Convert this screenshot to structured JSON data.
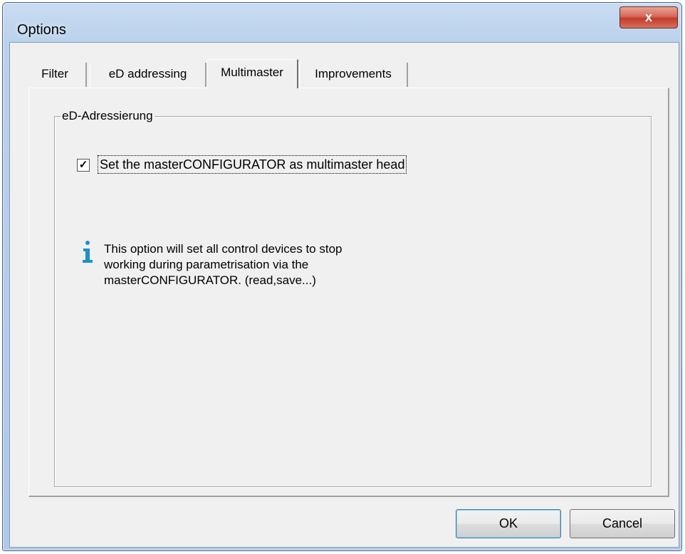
{
  "window": {
    "title": "Options",
    "close_glyph": "x"
  },
  "tabs": [
    {
      "label": "Filter",
      "active": false
    },
    {
      "label": "eD addressing",
      "active": false
    },
    {
      "label": "Multimaster",
      "active": true
    },
    {
      "label": "Improvements",
      "active": false
    }
  ],
  "group": {
    "legend": "eD-Adressierung",
    "checkbox": {
      "label": "Set the masterCONFIGURATOR as multimaster head",
      "checked": true,
      "check_glyph": "✓"
    },
    "info": {
      "icon": "info-icon",
      "lines": [
        "This option will set all control devices to stop",
        "working during parametrisation via the",
        "masterCONFIGURATOR. (read,save...)"
      ]
    }
  },
  "buttons": {
    "ok_label": "OK",
    "cancel_label": "Cancel"
  },
  "colors": {
    "frame": "#b9d1ec",
    "client": "#f0f0f0",
    "close_button": "#c13b2a",
    "info_icon": "#1e90c8"
  }
}
